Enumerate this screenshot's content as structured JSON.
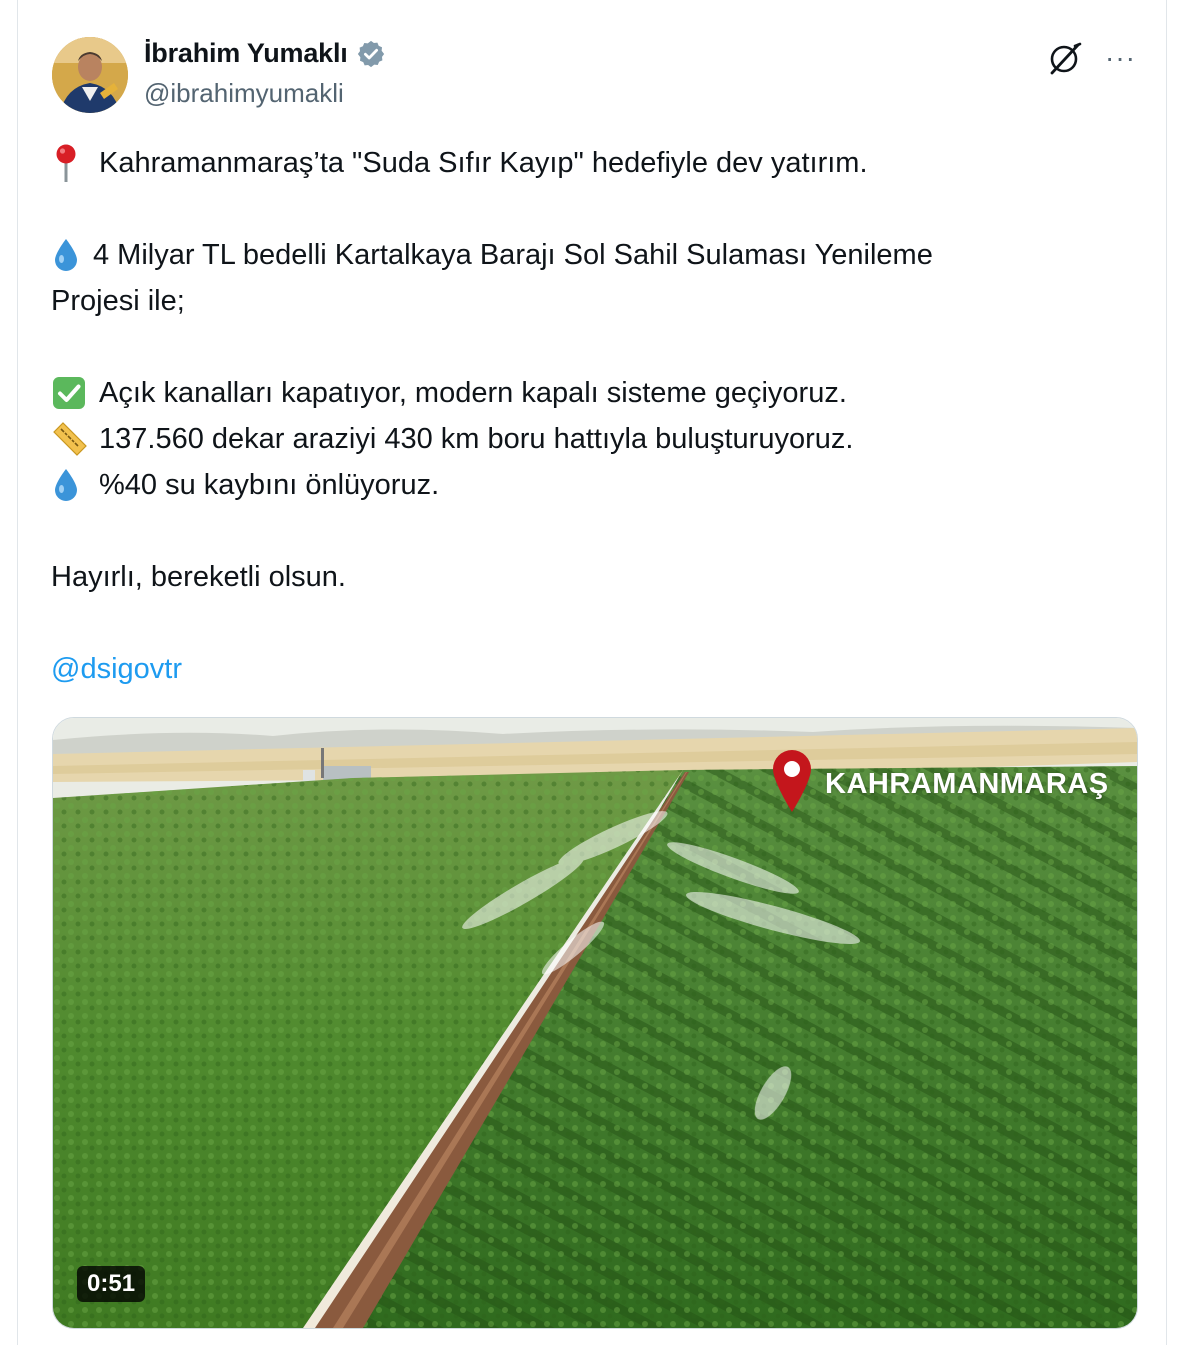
{
  "author": {
    "name": "İbrahim Yumaklı",
    "handle": "@ibrahimyumakli",
    "verified": true
  },
  "icons": {
    "verified": "verified-badge-icon",
    "grok": "grok-icon",
    "more": "more-options-icon",
    "pin": "round-pushpin-emoji",
    "droplet": "droplet-emoji",
    "check": "check-mark-button-emoji",
    "ruler": "straight-ruler-emoji"
  },
  "tweet": {
    "line1": "Kahramanmaraş’ta \"Suda Sıfır Kayıp\" hedefiyle dev yatırım.",
    "line2a": "4 Milyar TL bedelli Kartalkaya Barajı Sol Sahil Sulaması Yenileme",
    "line2b": "Projesi ile;",
    "bullet1": "Açık kanalları kapatıyor, modern kapalı sisteme geçiyoruz.",
    "bullet2": "137.560 dekar araziyi 430 km boru hattıyla buluşturuyoruz.",
    "bullet3": "%40 su kaybını önlüyoruz.",
    "closing": "Hayırlı, bereketli olsun.",
    "mention": "@dsigovtr"
  },
  "media": {
    "location_label": "KAHRAMANMARAŞ",
    "duration": "0:51"
  },
  "more_label": "···",
  "colors": {
    "link": "#1d9bf0",
    "verified": "#829aab",
    "pin_red": "#c4161c"
  }
}
